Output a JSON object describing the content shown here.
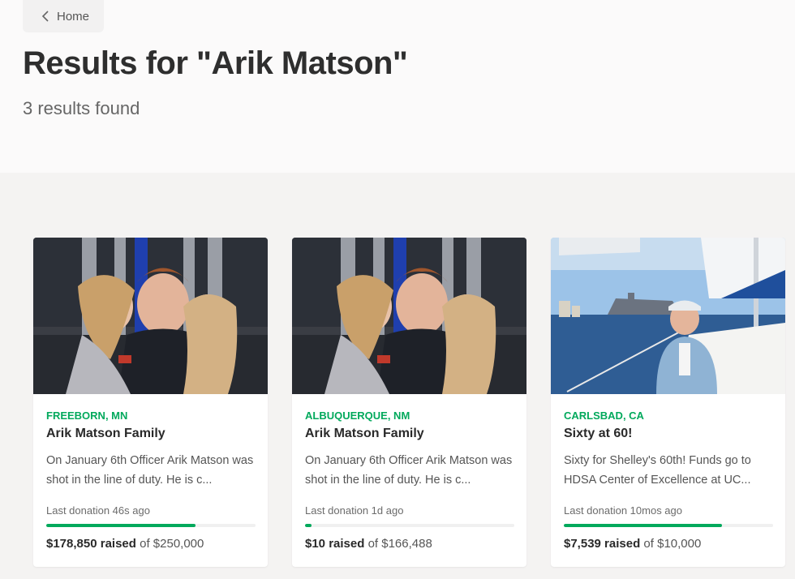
{
  "nav": {
    "home_label": "Home"
  },
  "header": {
    "title": "Results for \"Arik Matson\"",
    "count": "3 results found"
  },
  "cards": [
    {
      "location": "FREEBORN, MN",
      "title": "Arik Matson Family",
      "description": "On January 6th Officer Arik Matson was shot in the line of duty. He is c...",
      "last_donation": "Last donation 46s ago",
      "progress": 0.715,
      "raised": "$178,850 raised",
      "goal": "of $250,000",
      "image": "family-photo"
    },
    {
      "location": "ALBUQUERQUE, NM",
      "title": "Arik Matson Family",
      "description": "On January 6th Officer Arik Matson was shot in the line of duty. He is c...",
      "last_donation": "Last donation 1d ago",
      "progress": 0.03,
      "raised": "$10 raised",
      "goal": "of $166,488",
      "image": "family-photo"
    },
    {
      "location": "CARLSBAD, CA",
      "title": "Sixty at 60!",
      "description": "Sixty for Shelley's 60th! Funds go to HDSA Center of Excellence at UC...",
      "last_donation": "Last donation 10mos ago",
      "progress": 0.754,
      "raised": "$7,539 raised",
      "goal": "of $10,000",
      "image": "sailboat-photo"
    }
  ],
  "colors": {
    "accent": "#02a95c",
    "page_bg": "#fbfafa",
    "results_bg": "#f4f3f2"
  }
}
